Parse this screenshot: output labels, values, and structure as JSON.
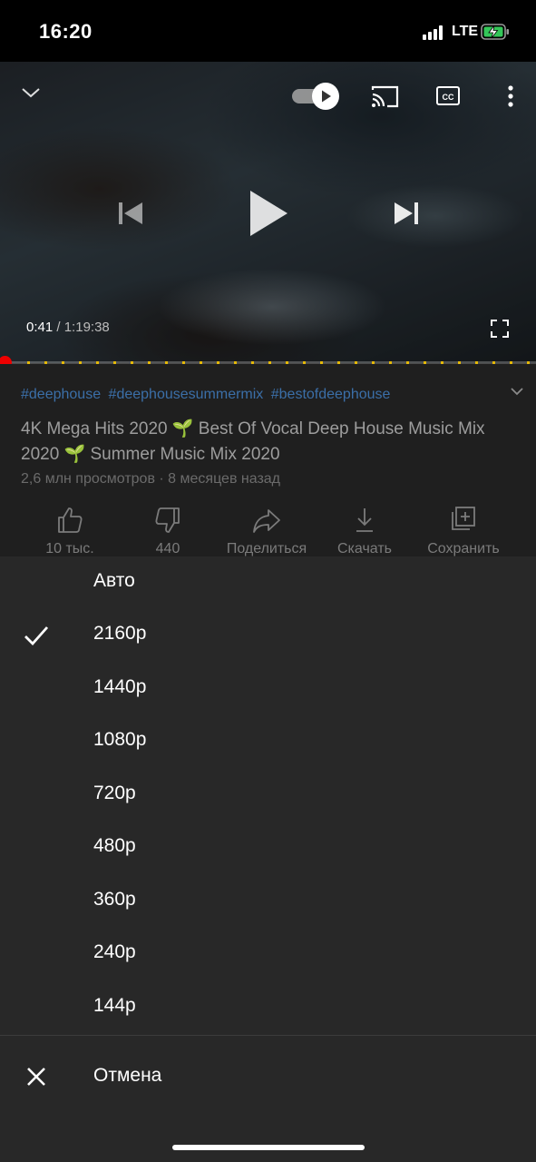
{
  "status": {
    "time": "16:20",
    "network": "LTE"
  },
  "player": {
    "current_time": "0:41",
    "separator": " / ",
    "duration": "1:19:38",
    "progress": 0.0086
  },
  "video": {
    "hashtags": [
      "#deephouse",
      "#deephousesummermix",
      "#bestofdeephouse"
    ],
    "title": "4K Mega Hits 2020 🌱 Best Of Vocal Deep House Music Mix 2020 🌱 Summer Music Mix 2020",
    "meta": "2,6 млн просмотров · 8 месяцев назад"
  },
  "actions": {
    "like": "10 тыс.",
    "dislike": "440",
    "share": "Поделиться",
    "download": "Скачать",
    "save": "Сохранить"
  },
  "quality_menu": {
    "selected": "2160p",
    "options": [
      "Авто",
      "2160p",
      "1440p",
      "1080p",
      "720p",
      "480p",
      "360p",
      "240p",
      "144p"
    ],
    "cancel": "Отмена"
  }
}
